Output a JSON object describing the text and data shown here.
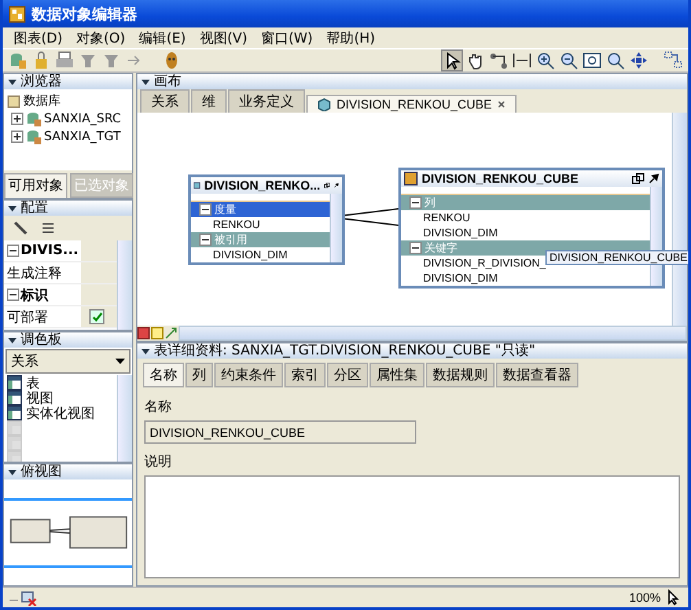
{
  "window": {
    "title": "数据对象编辑器"
  },
  "menu": [
    "图表(D)",
    "对象(O)",
    "编辑(E)",
    "视图(V)",
    "窗口(W)",
    "帮助(H)"
  ],
  "browser": {
    "title": "浏览器",
    "tree": [
      {
        "label": "数据库",
        "children": [
          {
            "label": "SANXIA_SRC",
            "expanded": false
          },
          {
            "label": "SANXIA_TGT",
            "expanded": false
          }
        ]
      }
    ],
    "tabs": [
      {
        "label": "可用对象",
        "selected": true,
        "disabled": false
      },
      {
        "label": "已选对象",
        "selected": false,
        "disabled": true
      }
    ]
  },
  "config": {
    "title": "配置",
    "properties": [
      {
        "kind": "group",
        "label": "DIVIS...",
        "expanded": true
      },
      {
        "kind": "text",
        "label": "生成注释"
      },
      {
        "kind": "group",
        "label": "标识",
        "expanded": true
      },
      {
        "kind": "checkbox",
        "label": "可部署",
        "checked": true
      }
    ]
  },
  "palette": {
    "title": "调色板",
    "dropdown": "关系",
    "items": [
      {
        "label": "表",
        "disabled": false
      },
      {
        "label": "视图",
        "disabled": false
      },
      {
        "label": "实体化视图",
        "disabled": false
      },
      {
        "disabled": true
      },
      {
        "disabled": true
      },
      {
        "disabled": true
      }
    ]
  },
  "bird_view": {
    "title": "俯视图"
  },
  "canvas": {
    "title": "画布",
    "tabs": [
      {
        "label": "关系",
        "selected": false
      },
      {
        "label": "维",
        "selected": false
      },
      {
        "label": "业务定义",
        "selected": false
      },
      {
        "label": "DIVISION_RENKOU_CUBE",
        "selected": true,
        "closable": true
      }
    ],
    "nodes": [
      {
        "title": "DIVISION_RENKO...",
        "rows": [
          {
            "kind": "group",
            "label": "度量",
            "selected": true
          },
          {
            "kind": "column",
            "label": "RENKOU",
            "selected": false
          },
          {
            "kind": "group",
            "label": "被引用",
            "selected": false
          },
          {
            "kind": "key",
            "label": "DIVISION_DIM",
            "selected": false
          }
        ]
      },
      {
        "title": "DIVISION_RENKOU_CUBE",
        "rows": [
          {
            "kind": "group",
            "label": "列",
            "selected": false
          },
          {
            "kind": "column",
            "label": "RENKOU",
            "selected": false
          },
          {
            "kind": "column",
            "label": "DIVISION_DIM",
            "selected": false
          },
          {
            "kind": "group",
            "label": "关键字",
            "selected": false
          },
          {
            "kind": "constraint",
            "label": "DIVISION_R_DIVISION_",
            "selected": false
          },
          {
            "kind": "column",
            "label": "DIVISION_DIM",
            "selected": false
          }
        ]
      }
    ],
    "tooltip": "DIVISION_RENKOU_CUBE"
  },
  "details": {
    "title": "表详细资料: SANXIA_TGT.DIVISION_RENKOU_CUBE \"只读\"",
    "tabs": [
      {
        "label": "名称",
        "selected": true
      },
      {
        "label": "列",
        "selected": false
      },
      {
        "label": "约束条件",
        "selected": false
      },
      {
        "label": "索引",
        "selected": false
      },
      {
        "label": "分区",
        "selected": false
      },
      {
        "label": "属性集",
        "selected": false
      },
      {
        "label": "数据规则",
        "selected": false
      },
      {
        "label": "数据查看器",
        "selected": false
      }
    ],
    "name_label": "名称",
    "name_value": "DIVISION_RENKOU_CUBE",
    "desc_label": "说明"
  },
  "status_bar": {
    "zoom": "100%"
  }
}
